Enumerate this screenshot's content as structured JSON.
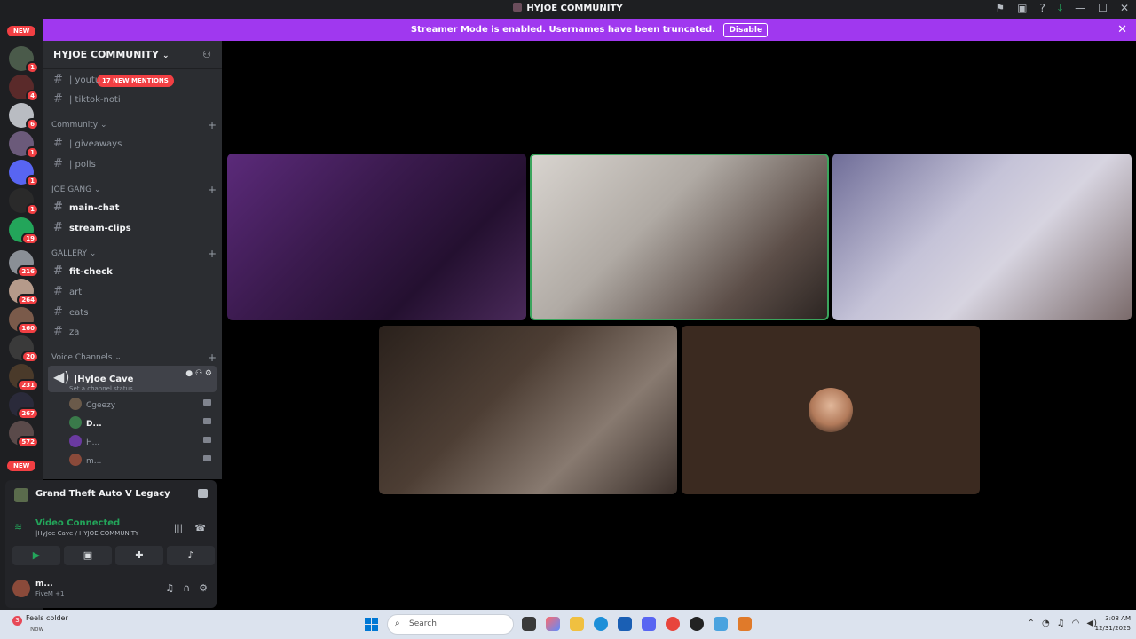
{
  "window": {
    "title": "HYJOE COMMUNITY"
  },
  "banner": {
    "text": "Streamer Mode is enabled. Usernames have been truncated.",
    "button": "Disable"
  },
  "server_rail": {
    "new_top": "NEW",
    "new_bottom": "NEW",
    "badges": [
      "1",
      "4",
      "6",
      "1",
      "1",
      "1",
      "19",
      "216",
      "264",
      "160",
      "20",
      "231",
      "267",
      "572"
    ]
  },
  "sidebar": {
    "server_name": "HYJOE COMMUNITY",
    "mentions_pill": "17 NEW MENTIONS",
    "channels_top": [
      {
        "name": "| youtu"
      },
      {
        "name": "| tiktok-noti"
      }
    ],
    "category_community": "Community",
    "channels_community": [
      {
        "name": "| giveaways"
      },
      {
        "name": "| polls"
      }
    ],
    "category_joe_gang": "JOE GANG",
    "channels_joe_gang": [
      {
        "name": "main-chat"
      },
      {
        "name": "stream-clips"
      }
    ],
    "category_gallery": "GALLERY",
    "channels_gallery": [
      {
        "name": "fit-check"
      },
      {
        "name": "art"
      },
      {
        "name": "eats"
      },
      {
        "name": "za"
      }
    ],
    "category_voice": "Voice Channels",
    "voice_channel": {
      "name": "|HyJoe Cave",
      "status": "Set a channel status"
    },
    "voice_users": [
      "Cgeezy",
      "D...",
      "H...",
      "m..."
    ]
  },
  "activity": {
    "game": "Grand Theft Auto V Legacy"
  },
  "voice_status": {
    "label": "Video Connected",
    "location": "|HyJoe Cave / HYJOE COMMUNITY"
  },
  "user": {
    "name": "m...",
    "status": "FiveM +1"
  },
  "taskbar": {
    "weather": "Feels colder",
    "weather_sub": "Now",
    "weather_badge": "3",
    "search_placeholder": "Search",
    "time": "3:08 AM",
    "date": "12/31/2025"
  }
}
